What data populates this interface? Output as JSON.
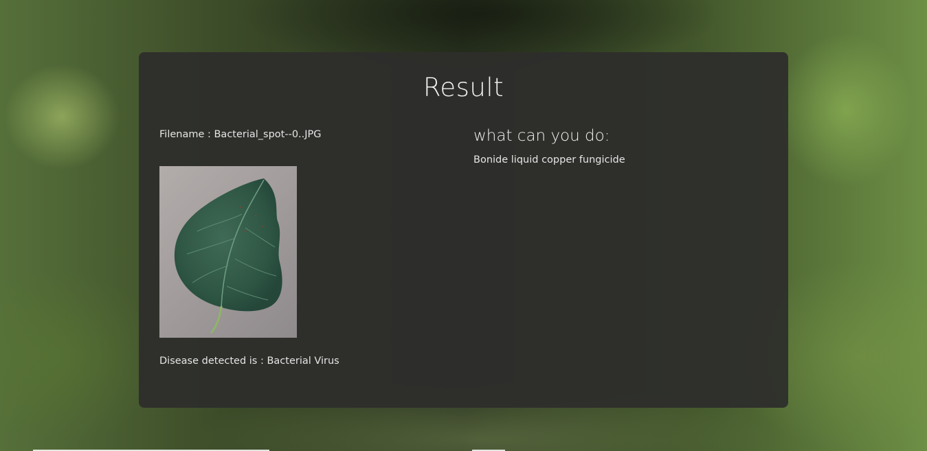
{
  "result": {
    "title": "Result",
    "filename_line": "Filename : Bacterial_spot--0..JPG",
    "disease_line": "Disease detected is : Bacterial Virus",
    "image_icon": "leaf-photo"
  },
  "advice": {
    "heading": "what can you do:",
    "text": "Bonide liquid copper fungicide"
  }
}
